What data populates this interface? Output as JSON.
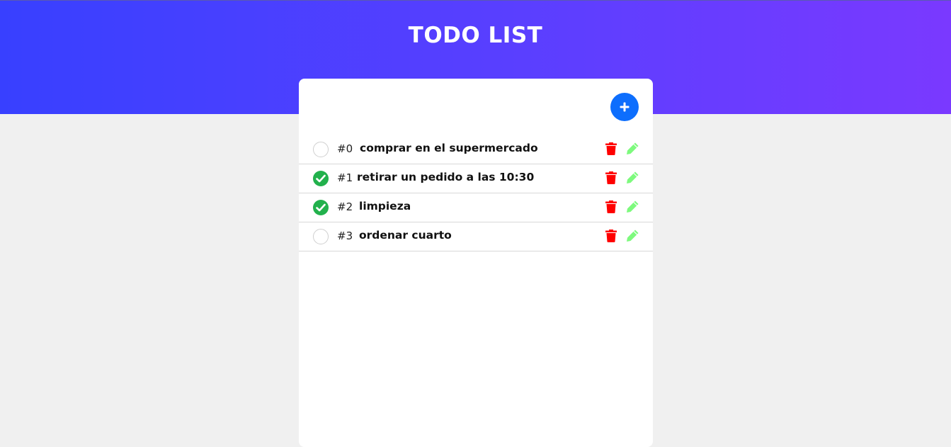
{
  "app": {
    "title": "TODO LIST"
  },
  "add_button": {
    "icon": "plus-icon"
  },
  "colors": {
    "header_start": "#3840ff",
    "header_end": "#7a39ff",
    "add_button": "#0d6efd",
    "done": "#22b14c",
    "delete": "#ff0000",
    "edit": "#7dfa7d"
  },
  "todos": [
    {
      "number": "#0",
      "text": "comprar en el supermercado",
      "done": false
    },
    {
      "number": "#1",
      "text": "retirar un pedido a las 10:30",
      "done": true
    },
    {
      "number": "#2",
      "text": "limpieza",
      "done": true
    },
    {
      "number": "#3",
      "text": "ordenar cuarto",
      "done": false
    }
  ]
}
